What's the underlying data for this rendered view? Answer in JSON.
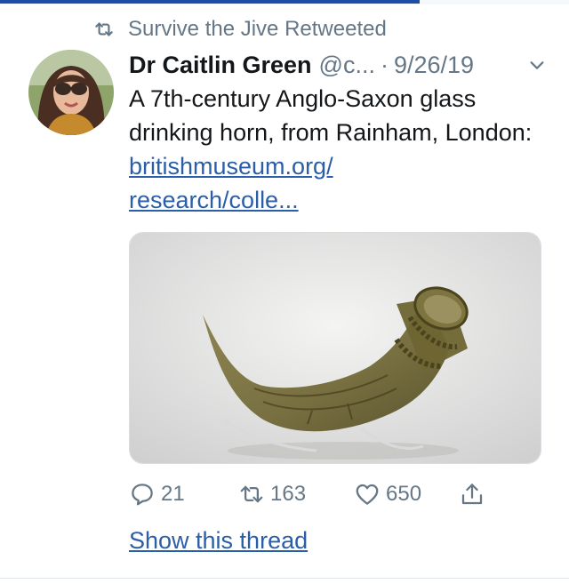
{
  "retweet": {
    "text": "Survive the Jive Retweeted",
    "icon": "retweet-icon"
  },
  "author": {
    "name": "Dr Caitlin Green",
    "handle": "@c...",
    "separator": "·",
    "date": "9/26/19"
  },
  "tweet": {
    "text": "A 7th-century Anglo-Saxon glass drinking horn, from Rainham, London: ",
    "link_line1": "britishmuseum.org/",
    "link_line2": "research/colle..."
  },
  "actions": {
    "replies": "21",
    "retweets": "163",
    "likes": "650"
  },
  "thread": {
    "label": "Show this thread"
  },
  "colors": {
    "link": "#2b5ea8",
    "muted": "#657786",
    "text": "#14171a",
    "accent_bar": "#1d4fa8"
  }
}
